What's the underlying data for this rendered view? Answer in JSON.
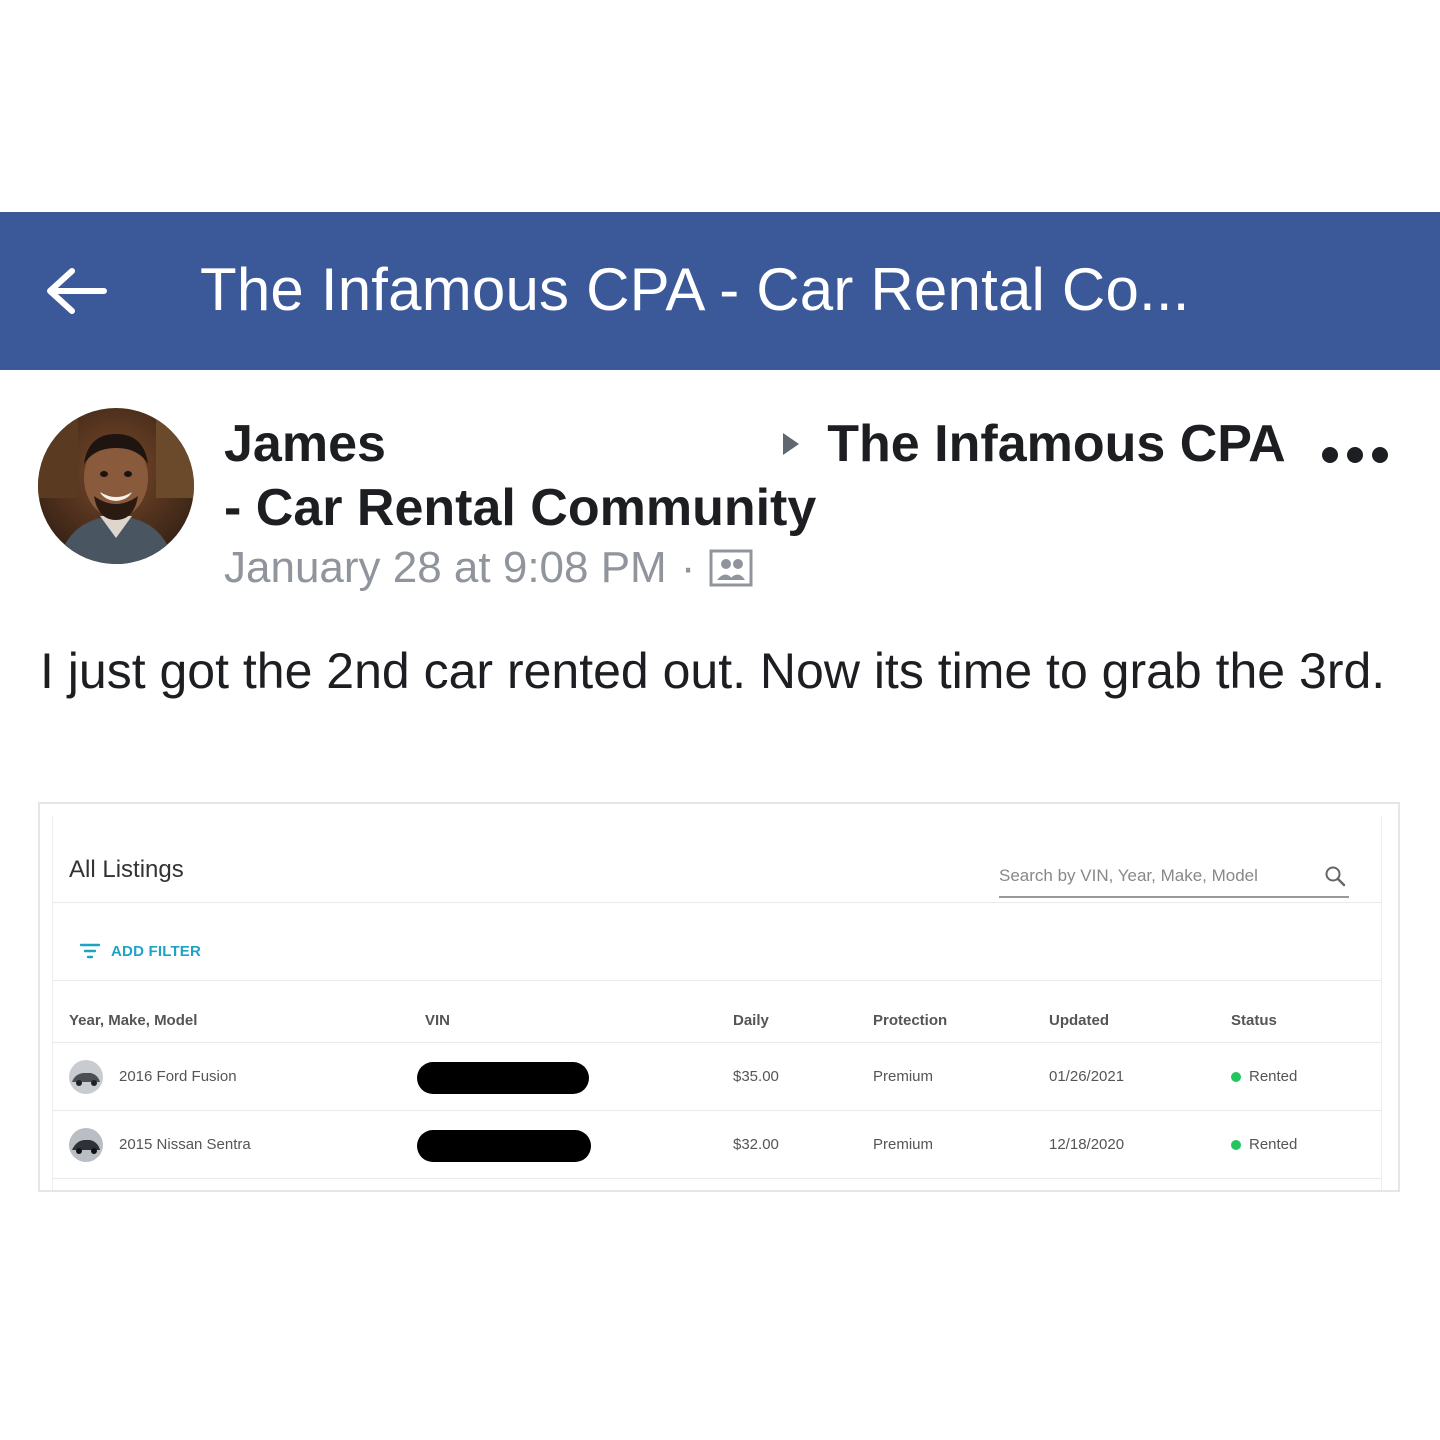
{
  "header": {
    "title": "The Infamous CPA - Car Rental Co...",
    "bg_color": "#3b5998",
    "back_icon": "arrow-left-icon"
  },
  "post": {
    "author_first_name": "James",
    "group_name": "The Infamous CPA - Car Rental Community",
    "timestamp": "January 28 at 9:08 PM",
    "separator": "·",
    "audience_icon": "group-members-icon",
    "more_icon": "more-dots-icon",
    "text": "I just got the 2nd car rented out. Now its time to grab the 3rd."
  },
  "listing": {
    "title": "All Listings",
    "search_placeholder": "Search by VIN, Year, Make, Model",
    "filter_label": "ADD FILTER",
    "accent_color": "#1ea3c7",
    "columns": [
      "Year, Make, Model",
      "VIN",
      "Daily",
      "Protection",
      "Updated",
      "Status"
    ],
    "rows": [
      {
        "vehicle": "2016 Ford Fusion",
        "daily": "$35.00",
        "protection": "Premium",
        "updated": "01/26/2021",
        "status": "Rented"
      },
      {
        "vehicle": "2015 Nissan Sentra",
        "daily": "$32.00",
        "protection": "Premium",
        "updated": "12/18/2020",
        "status": "Rented"
      }
    ],
    "status_color": "#22c55e"
  }
}
